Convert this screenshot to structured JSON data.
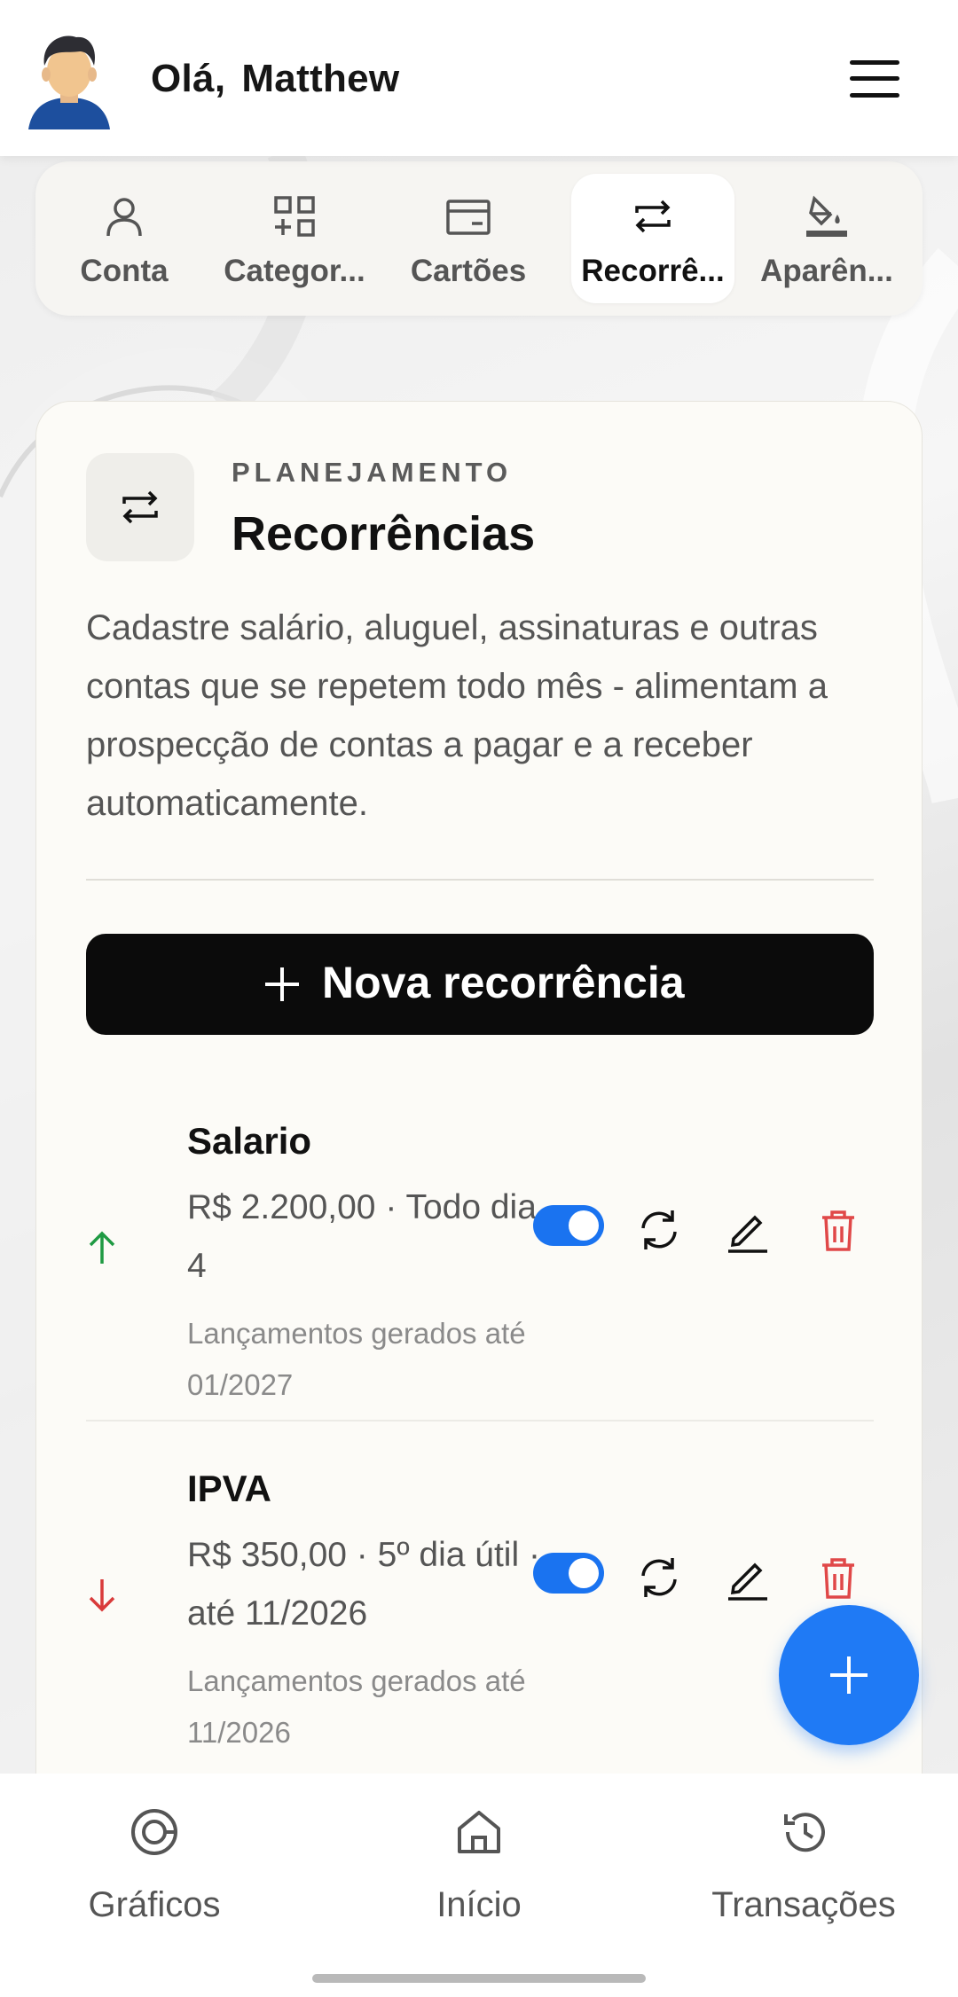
{
  "header": {
    "greeting": "Olá,",
    "user_name": "Matthew",
    "menu_icon": "hamburger-menu-icon"
  },
  "tabs": [
    {
      "label": "Conta",
      "icon": "user-icon",
      "active": false
    },
    {
      "label": "Categor...",
      "icon": "category-grid-icon",
      "active": false
    },
    {
      "label": "Cartões",
      "icon": "card-icon",
      "active": false
    },
    {
      "label": "Recorrê...",
      "icon": "repeat-icon",
      "active": true
    },
    {
      "label": "Aparên...",
      "icon": "paint-bucket-icon",
      "active": false
    }
  ],
  "section": {
    "eyebrow": "PLANEJAMENTO",
    "title": "Recorrências",
    "description": "Cadastre salário, aluguel, assinaturas e outras contas que se repetem todo mês - alimentam a prospecção de contas a pagar e a receber automaticamente.",
    "new_button": "Nova recorrência"
  },
  "recurrences": [
    {
      "name": "Salario",
      "info": "R$ 2.200,00 · Todo dia 4",
      "note": "Lançamentos gerados até 01/2027",
      "direction": "income",
      "enabled": true
    },
    {
      "name": "IPVA",
      "info": "R$ 350,00 · 5º dia útil · até 11/2026",
      "note": "Lançamentos gerados até 11/2026",
      "direction": "expense",
      "enabled": true
    }
  ],
  "bottom_nav": [
    {
      "label": "Gráficos",
      "icon": "chart-icon"
    },
    {
      "label": "Início",
      "icon": "home-icon"
    },
    {
      "label": "Transações",
      "icon": "history-icon"
    }
  ],
  "colors": {
    "accent": "#1f7af5",
    "income": "#1f9a43",
    "expense": "#d93a3a",
    "delete": "#e04848",
    "card_bg": "#fcfbf7"
  }
}
